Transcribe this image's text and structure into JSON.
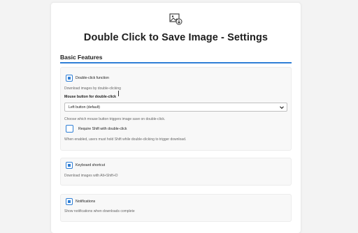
{
  "page": {
    "title": "Double Click to Save Image - Settings",
    "logo_icon": "image-save-icon",
    "accent_color": "#2f7fd6"
  },
  "basic": {
    "section_title": "Basic Features",
    "double_click": {
      "label": "Double-click function",
      "checked": true,
      "description": "Download images by double-clicking"
    },
    "mouse_button": {
      "label": "Mouse button for double-click",
      "selected": "Left button (default)",
      "description": "Choose which mouse button triggers image save on double-click."
    },
    "require_shift": {
      "label": "Require Shift with double-click",
      "checked": false,
      "description": "When enabled, users must hold Shift while double-clicking to trigger download."
    },
    "keyboard_shortcut": {
      "label": "Keyboard shortcut",
      "checked": true,
      "description": "Download images with Alt+Shift+D"
    },
    "notifications": {
      "label": "Notifications",
      "checked": true,
      "description": "Show notifications when downloads complete"
    }
  }
}
